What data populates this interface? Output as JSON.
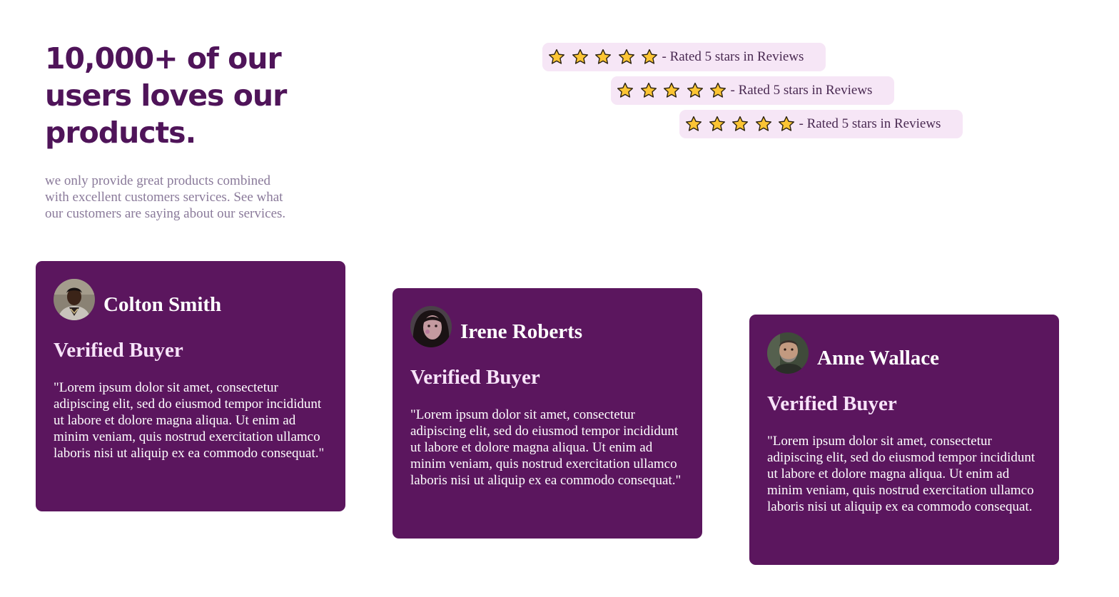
{
  "hero": {
    "heading": "10,000+ of our users loves our products.",
    "subtext": "we only provide great products combined with excellent customers services. See what our customers are saying about our services."
  },
  "ratings": [
    {
      "stars": 5,
      "text": "- Rated 5 stars in Reviews"
    },
    {
      "stars": 5,
      "text": "- Rated 5 stars in Reviews"
    },
    {
      "stars": 5,
      "text": "- Rated 5 stars in Reviews"
    }
  ],
  "testimonials": [
    {
      "name": "Colton Smith",
      "role": "Verified Buyer",
      "quote": "\"Lorem ipsum dolor sit amet, consectetur adipiscing elit, sed do eiusmod tempor incididunt ut labore et dolore magna aliqua. Ut enim ad minim veniam, quis nostrud exercitation ullamco laboris nisi ut aliquip ex ea commodo consequat.\""
    },
    {
      "name": "Irene Roberts",
      "role": "Verified Buyer",
      "quote": "\"Lorem ipsum dolor sit amet, consectetur adipiscing elit, sed do eiusmod tempor incididunt ut labore et dolore magna aliqua. Ut enim ad minim veniam, quis nostrud exercitation ullamco laboris nisi ut aliquip ex ea commodo consequat.\""
    },
    {
      "name": "Anne Wallace",
      "role": "Verified Buyer",
      "quote": "\"Lorem ipsum dolor sit amet, consectetur adipiscing elit, sed do eiusmod tempor incididunt ut labore et dolore magna aliqua. Ut enim ad minim veniam, quis nostrud exercitation ullamco laboris nisi ut aliquip ex ea commodo consequat."
    }
  ],
  "colors": {
    "brand": "#5b165e",
    "heading": "#4f1459",
    "pill": "#f6e6f6",
    "star": "#fcc534"
  },
  "icons": {
    "star": "star-icon"
  }
}
